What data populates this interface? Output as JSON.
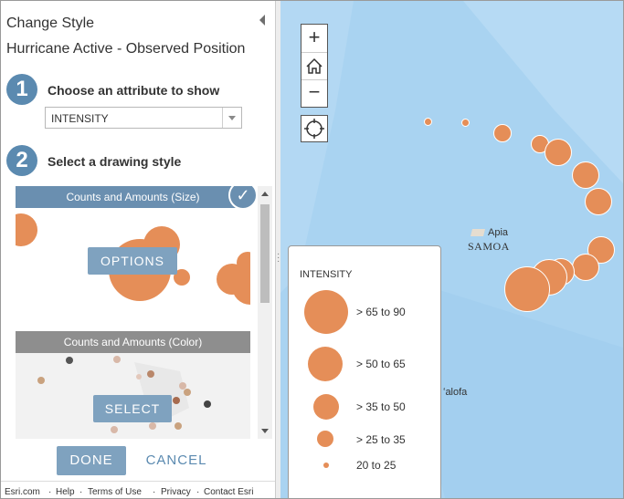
{
  "panel": {
    "title": "Change Style",
    "layer_title": "Hurricane Active - Observed Position",
    "step1": {
      "number": "1",
      "label": "Choose an attribute to show"
    },
    "attribute_select": {
      "value": "INTENSITY"
    },
    "step2": {
      "number": "2",
      "label": "Select a drawing style"
    },
    "style_cards": [
      {
        "title": "Counts and Amounts (Size)",
        "button": "OPTIONS",
        "selected": true
      },
      {
        "title": "Counts and Amounts (Color)",
        "button": "SELECT",
        "selected": false
      }
    ],
    "done_label": "DONE",
    "cancel_label": "CANCEL",
    "footer": {
      "esri": "Esri.com",
      "sep": "·",
      "help": "Help",
      "terms": "Terms of Use",
      "privacy": "Privacy",
      "contact": "Contact Esri"
    }
  },
  "map": {
    "zoom_in": "+",
    "zoom_out": "−",
    "places": {
      "apia": "Apia",
      "samoa": "SAMOA",
      "nukualofa": "ʻalofa"
    },
    "legend": {
      "title": "INTENSITY",
      "rows": [
        {
          "label": "> 65 to 90",
          "size_level": 5
        },
        {
          "label": "> 50 to 65",
          "size_level": 4
        },
        {
          "label": "> 35 to 50",
          "size_level": 3
        },
        {
          "label": "> 25 to 35",
          "size_level": 2
        },
        {
          "label": "20 to 25",
          "size_level": 1
        }
      ]
    },
    "marker_color": "#e58e58",
    "icons": [
      "home-icon",
      "locate-icon",
      "check-icon",
      "collapse-arrow-icon"
    ]
  }
}
